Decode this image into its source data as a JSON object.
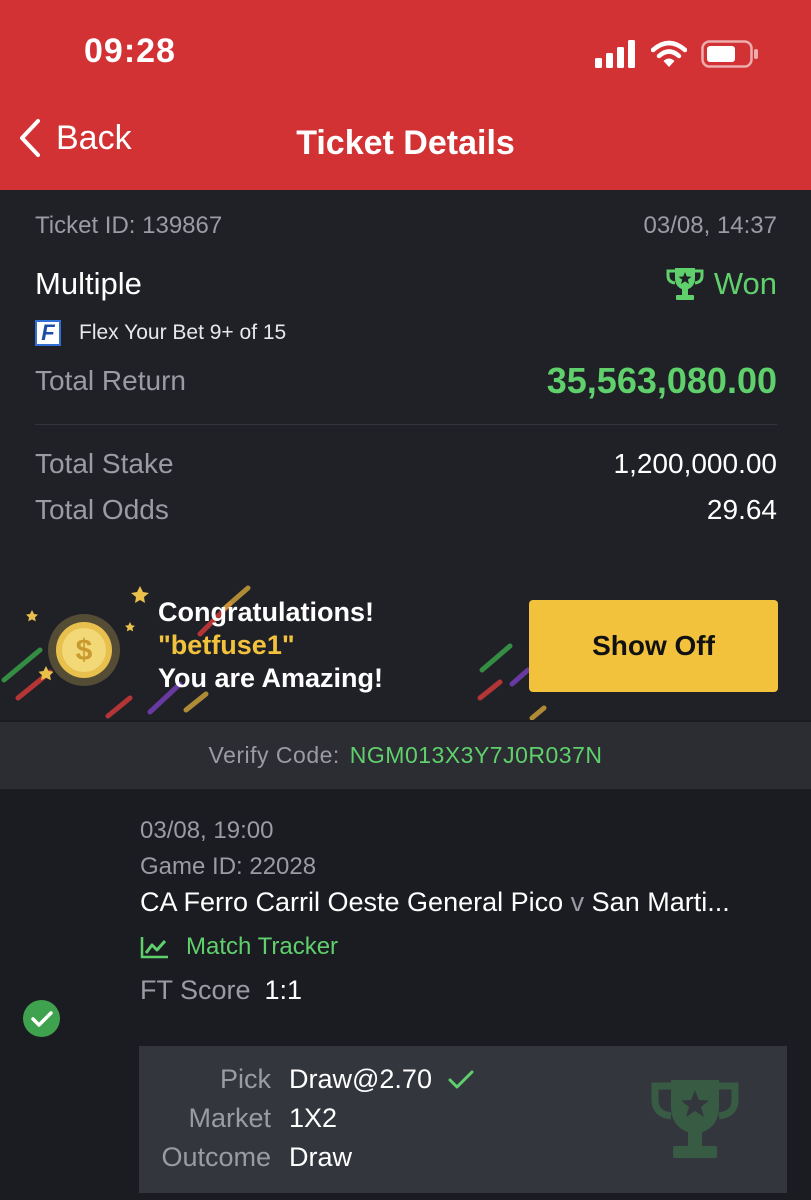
{
  "status_bar": {
    "time": "09:28"
  },
  "header": {
    "back_label": "Back",
    "title": "Ticket Details"
  },
  "ticket": {
    "id_label": "Ticket ID: 139867",
    "datetime": "03/08, 14:37",
    "bet_type": "Multiple",
    "status": "Won",
    "flex_text": "Flex Your Bet 9+ of 15",
    "total_return_label": "Total Return",
    "total_return": "35,563,080.00",
    "total_stake_label": "Total Stake",
    "total_stake": "1,200,000.00",
    "total_odds_label": "Total Odds",
    "total_odds": "29.64"
  },
  "banner": {
    "line1": "Congratulations!",
    "line2": "\"betfuse1\"",
    "line3": "You are Amazing!",
    "button": "Show Off"
  },
  "verify": {
    "label": "Verify Code:",
    "code": "NGM013X3Y7J0R037N"
  },
  "selection": {
    "datetime": "03/08, 19:00",
    "game_id": "Game ID: 22028",
    "home": "CA Ferro Carril Oeste General Pico",
    "vs": "v",
    "away": "San Marti...",
    "tracker": "Match Tracker",
    "score_label": "FT Score",
    "score": "1:1",
    "pick_label": "Pick",
    "pick": "Draw@2.70",
    "market_label": "Market",
    "market": "1X2",
    "outcome_label": "Outcome",
    "outcome": "Draw"
  },
  "colors": {
    "header": "#d33234",
    "win_green": "#5fd06b",
    "button_yellow": "#f2c23d",
    "background": "#1b1c21"
  },
  "icons": [
    "signal-icon",
    "wifi-icon",
    "battery-icon",
    "back-chevron-icon",
    "trophy-icon",
    "flex-logo-icon",
    "coin-icon",
    "chart-icon",
    "check-circle-icon",
    "checkmark-icon"
  ]
}
